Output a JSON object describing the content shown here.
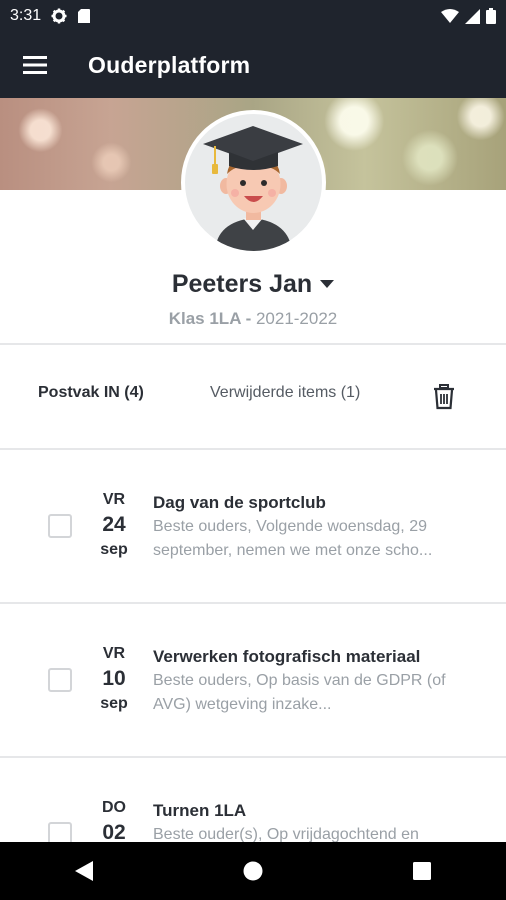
{
  "status_bar": {
    "time": "3:31",
    "icons": [
      "settings-icon",
      "sd-card-icon",
      "wifi-icon",
      "signal-icon",
      "battery-icon"
    ]
  },
  "app_bar": {
    "title": "Ouderplatform",
    "menu_icon": "hamburger-menu-icon",
    "background": "#1f242d"
  },
  "profile": {
    "name": "Peeters Jan",
    "class_label": "Klas 1LA",
    "separator": " - ",
    "school_year": "2021-2022",
    "dropdown_icon": "caret-down-icon"
  },
  "tabs": {
    "inbox_label": "Postvak IN (4)",
    "deleted_label": "Verwijderde items (1)",
    "trash_icon": "trash-icon"
  },
  "messages": [
    {
      "dow": "VR",
      "day": "24",
      "month": "sep",
      "title": "Dag van de sportclub",
      "preview": "Beste ouders,   Volgende woensdag, 29 september, nemen we met onze scho..."
    },
    {
      "dow": "VR",
      "day": "10",
      "month": "sep",
      "title": "Verwerken fotografisch materiaal",
      "preview": "Beste ouders, Op basis van de GDPR (of AVG) wetgeving inzake..."
    },
    {
      "dow": "DO",
      "day": "02",
      "month": "",
      "title": "Turnen 1LA",
      "preview": "Beste ouder(s), Op vrijdagochtend en"
    }
  ],
  "nav_bar": {
    "icons": [
      "back-icon",
      "home-icon",
      "recents-icon"
    ]
  }
}
